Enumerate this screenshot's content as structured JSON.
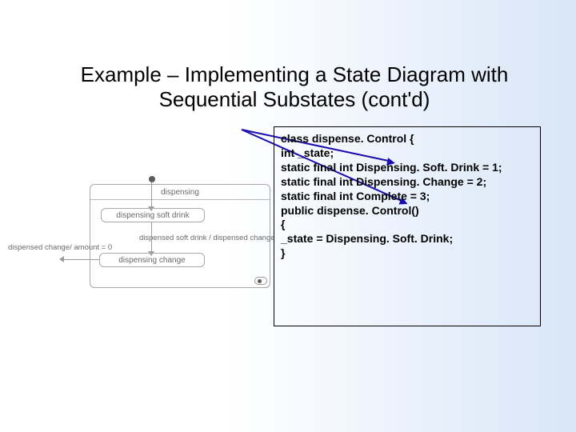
{
  "title": "Example – Implementing a State Diagram with Sequential Substates (cont'd)",
  "code": {
    "l0": "class dispense. Control {",
    "l1": "  int _state;",
    "l2": "  static final int Dispensing. Soft. Drink = 1;",
    "l3": "  static final int Dispensing. Change = 2;",
    "l4": "  static final int Complete = 3;",
    "l5": "  public dispense. Control()",
    "l6": "  {",
    "l7": "    _state = Dispensing. Soft. Drink;",
    "l8": "  }"
  },
  "diagram": {
    "outer": "dispensing",
    "sub1": "dispensing soft drink",
    "sub2": "dispensing change",
    "transition_exit": "dispensed change/ amount = 0",
    "transition_mid": "dispensed soft drink / dispensed change"
  }
}
